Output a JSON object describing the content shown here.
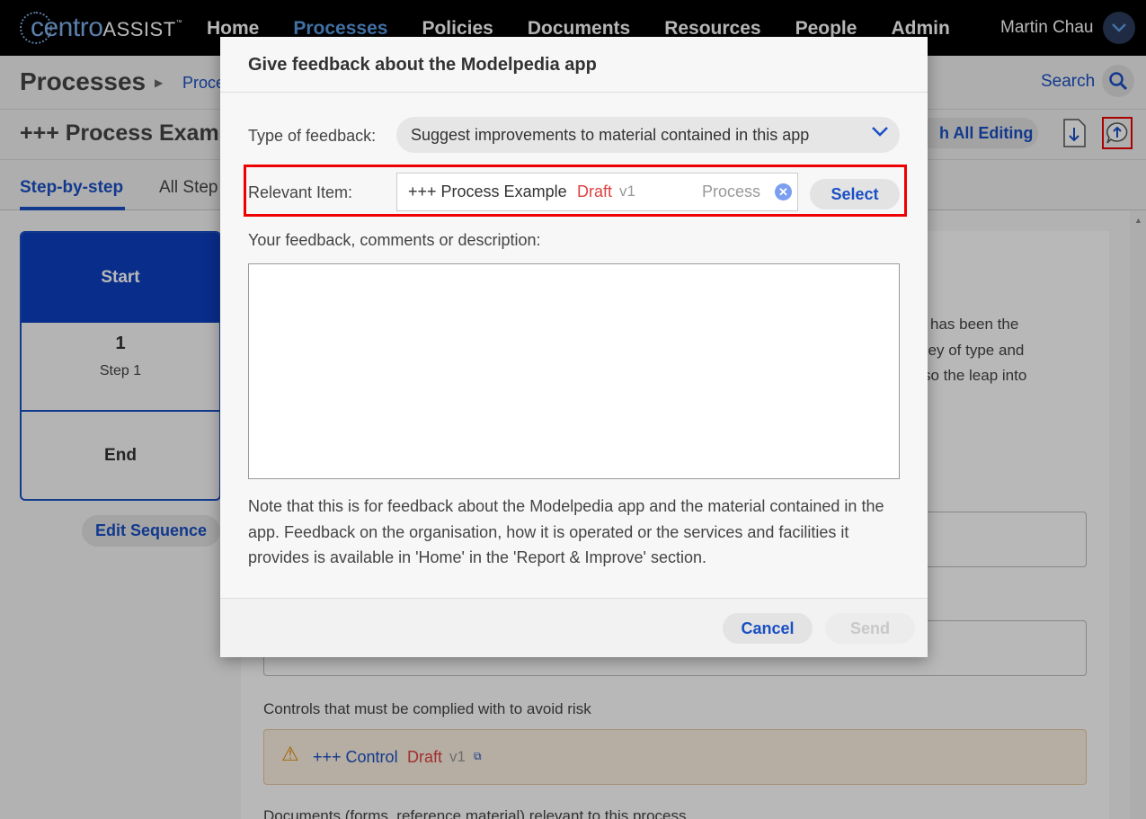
{
  "app": {
    "logo_primary": "centro",
    "logo_secondary": "ASSIST",
    "logo_tm": "™"
  },
  "nav": {
    "items": [
      {
        "label": "Home"
      },
      {
        "label": "Processes",
        "active": true
      },
      {
        "label": "Policies"
      },
      {
        "label": "Documents"
      },
      {
        "label": "Resources"
      },
      {
        "label": "People"
      },
      {
        "label": "Admin"
      }
    ],
    "user_name": "Martin Chau"
  },
  "breadcrumb": {
    "title": "Processes",
    "link": "Proce"
  },
  "search": {
    "label": "Search"
  },
  "page": {
    "title": "+++ Process Examp",
    "edit_label": "h All Editing"
  },
  "tabs": [
    {
      "label": "Step-by-step",
      "active": true
    },
    {
      "label": "All Step"
    }
  ],
  "steps": {
    "start": "Start",
    "step_number": "1",
    "step_label": "Step 1",
    "end": "End",
    "edit_sequence": "Edit Sequence"
  },
  "content": {
    "line1": "has been the",
    "line2": "lley of type and",
    "line3": "so the leap into",
    "controls_heading": "Controls that must be complied with to avoid risk",
    "control": {
      "name": "+++ Control",
      "status": "Draft",
      "version": "v1"
    },
    "documents_heading": "Documents (forms, reference material) relevant to this process"
  },
  "modal": {
    "title": "Give feedback about the Modelpedia app",
    "type_label": "Type of feedback:",
    "type_value": "Suggest improvements to material contained in this app",
    "item_label": "Relevant Item:",
    "item": {
      "name": "+++ Process Example",
      "status": "Draft",
      "version": "v1",
      "type": "Process"
    },
    "select_label": "Select",
    "feedback_label": "Your feedback, comments or description:",
    "feedback_value": "",
    "note": "Note that this is for feedback about the Modelpedia app and the material contained in the app. Feedback on the organisation, how it is operated or the services and facilities it provides is available in 'Home' in the 'Report & Improve' section.",
    "cancel_label": "Cancel",
    "send_label": "Send"
  },
  "colors": {
    "accent": "#1a4fc4",
    "nav_active": "#5d9ee8",
    "draft": "#e04040",
    "highlight": "#ee0000"
  }
}
